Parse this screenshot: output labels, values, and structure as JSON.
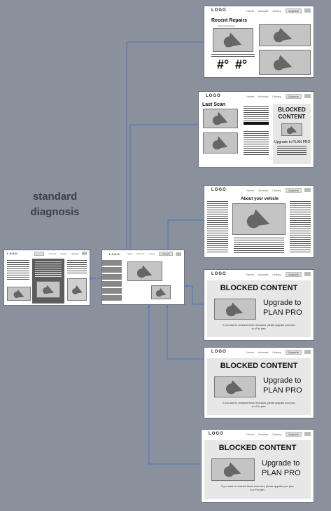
{
  "title": "standard diagnosis",
  "nav": {
    "logo": "LOGO",
    "home": "Home",
    "account": "Account",
    "library": "Library",
    "upgrade": "Upgrade"
  },
  "frame1": {
    "heading": "Recent Repairs",
    "caption": "Discovered issues",
    "big_left": "#°",
    "big_right": "#°"
  },
  "frame2": {
    "heading": "Last Scan",
    "blocked": "BLOCKED CONTENT",
    "upgrade": "Upgrade to PLAN PRO",
    "cta": "Upgrade"
  },
  "frame3": {
    "heading": "About your vehicle"
  },
  "blocked_frame": {
    "blocked": "BLOCKED CONTENT",
    "upgrade_line1": "Upgrade to",
    "upgrade_line2": "PLAN PRO",
    "note": "If you want to consume these resources, please upgrade your plan to a Pro plan."
  },
  "colors": {
    "background": "#8a909c",
    "connector": "#4a78c8",
    "placeholder": "#c4c4c4"
  }
}
